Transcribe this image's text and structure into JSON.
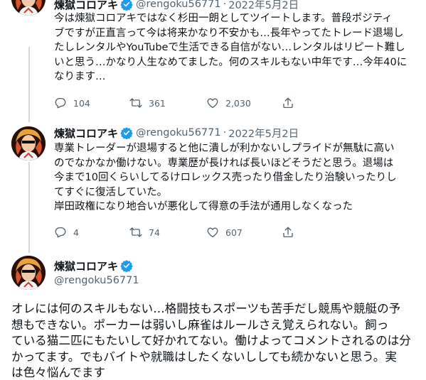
{
  "colors": {
    "text": "#0f1419",
    "secondary": "#536471",
    "verified": "#1d9bf0",
    "divider": "#eff3f4"
  },
  "tweets": [
    {
      "name": "煉獄コロアキ",
      "handle": "@rengoku56771",
      "separator": "·",
      "date": "2022年5月2日",
      "lines": [
        "今は煉獄コロアキではなく杉田一朗としてツイートします。普段ポジティ",
        "ブですが正直言って今は将来かなり不安かも…長年やってたトレード退場し",
        "たしレンタルやYouTubeで生活できる自信がない…レンタルはリピート難し",
        "いと思う…かなり人生なめてました。何のスキルもない中年です…今年40に",
        "なります…"
      ],
      "replies": "104",
      "retweets": "361",
      "likes": "2,030",
      "icons": [
        "reply-icon",
        "retweet-icon",
        "like-icon",
        "share-icon"
      ]
    },
    {
      "name": "煉獄コロアキ",
      "handle": "@rengoku56771",
      "separator": "·",
      "date": "2022年5月2日",
      "lines": [
        "専業トレーダーが退場すると他に潰しが利かないしプライドが無駄に高い",
        "のでなかなか働けない。専業歴が長ければ長いほどそうだと思う。退場は",
        "今まで10回くらいしてるけロレックス売ったり借金したり治験いったりし",
        "てすぐに復活していた。",
        "岸田政権になり地合いが悪化して得意の手法が通用しなくなった"
      ],
      "replies": "4",
      "retweets": "74",
      "likes": "607",
      "icons": [
        "reply-icon",
        "retweet-icon",
        "like-icon",
        "share-icon"
      ]
    },
    {
      "name": "煉獄コロアキ",
      "handle": "@rengoku56771",
      "lines": [
        "オレには何のスキルもない…格闘技もスポーツも苦手だし競馬や競艇の予",
        "想もできない。ポーカーは弱いし麻雀はルールさえ覚えられない。飼っ",
        "ている猫二匹にもたいして好かれてない。働けよってコメントされるのは分",
        "かってます。でもバイトや就職はしたくないししても続かないと思う。実",
        "は色々悩んでます"
      ]
    }
  ]
}
